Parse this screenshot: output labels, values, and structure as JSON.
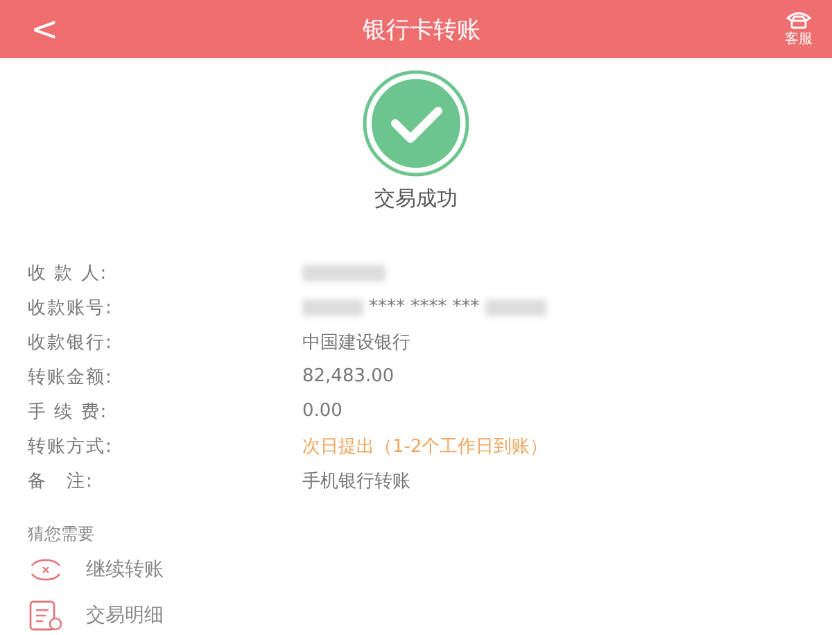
{
  "header": {
    "back": "<",
    "title": "银行卡转账",
    "service_label": "客服"
  },
  "result": {
    "status": "交易成功"
  },
  "details": [
    {
      "label": "收 款 人:",
      "kind": "redacted"
    },
    {
      "label": "收款账号:",
      "value": "**** **** ***",
      "kind": "masked"
    },
    {
      "label": "收款银行:",
      "value": "中国建设银行",
      "kind": "plain"
    },
    {
      "label": "转账金额:",
      "value": "82,483.00",
      "kind": "plain"
    },
    {
      "label": "手 续 费:",
      "value": "0.00",
      "kind": "plain"
    },
    {
      "label": "转账方式:",
      "value": "次日提出（1-2个工作日到账）",
      "kind": "highlight"
    },
    {
      "label": "备　注:",
      "value": "手机银行转账",
      "kind": "plain"
    }
  ],
  "suggestions": {
    "title": "猜您需要",
    "items": [
      {
        "label": "继续转账",
        "kind": "transfer"
      },
      {
        "label": "交易明细",
        "kind": "details"
      }
    ]
  }
}
